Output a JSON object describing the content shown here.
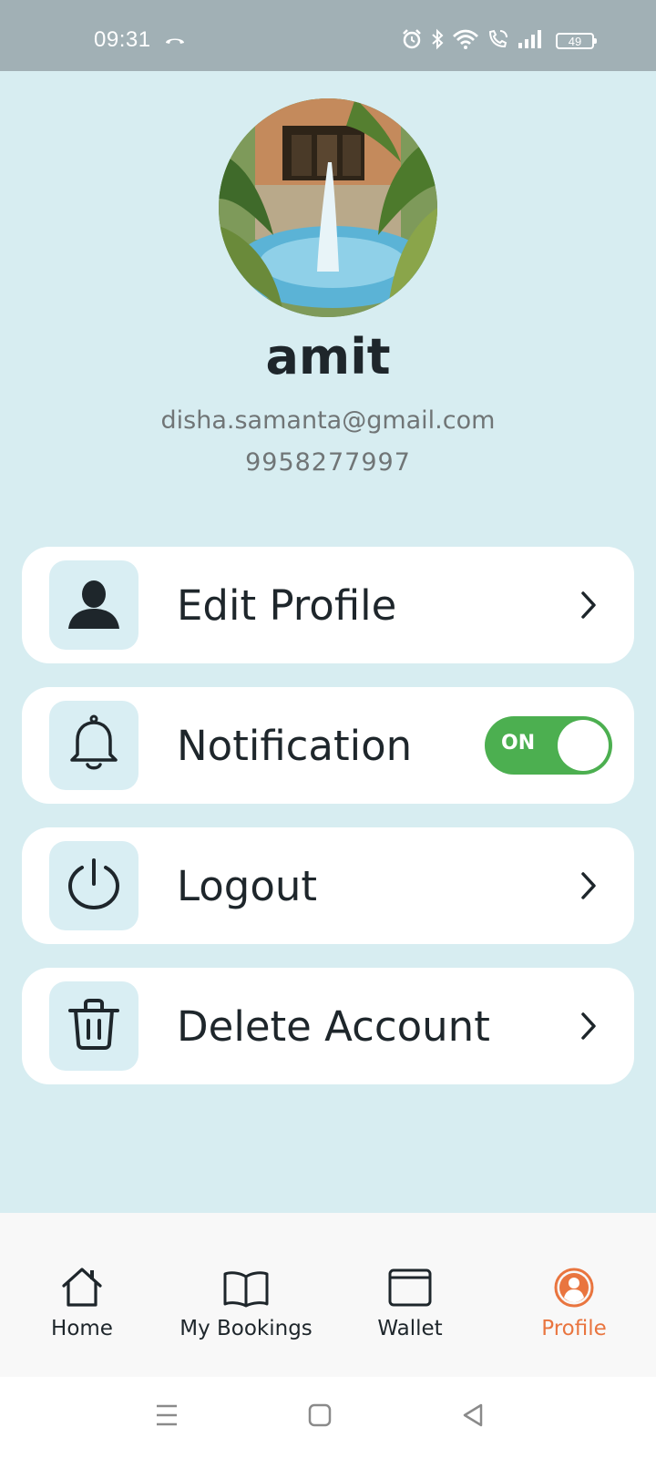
{
  "status_bar": {
    "time": "09:31",
    "battery_level": "49",
    "icons": [
      "call-icon",
      "alarm-icon",
      "bluetooth-icon",
      "wifi-icon",
      "wifi-call-icon",
      "signal-icon",
      "battery-icon"
    ]
  },
  "profile": {
    "name": "amit",
    "email": "disha.samanta@gmail.com",
    "phone": "9958277997",
    "avatar_icon": "avatar-photo"
  },
  "menu": [
    {
      "label": "Edit Profile",
      "icon": "person-icon",
      "action": "chevron"
    },
    {
      "label": "Notification",
      "icon": "bell-icon",
      "action": "toggle",
      "toggle_label": "ON",
      "toggle_on": true
    },
    {
      "label": "Logout",
      "icon": "power-icon",
      "action": "chevron"
    },
    {
      "label": "Delete Account",
      "icon": "trash-icon",
      "action": "chevron"
    }
  ],
  "bottom_nav": [
    {
      "label": "Home",
      "icon": "home-icon",
      "active": false
    },
    {
      "label": "My Bookings",
      "icon": "book-icon",
      "active": false
    },
    {
      "label": "Wallet",
      "icon": "wallet-icon",
      "active": false
    },
    {
      "label": "Profile",
      "icon": "profile-icon",
      "active": true
    }
  ],
  "colors": {
    "background": "#d7edf1",
    "status_bar": "#a1b0b5",
    "accent": "#e9753f",
    "toggle_on": "#4caf50",
    "icon_box": "#d9eef3",
    "text_primary": "#1e262b",
    "text_secondary": "#707576"
  }
}
